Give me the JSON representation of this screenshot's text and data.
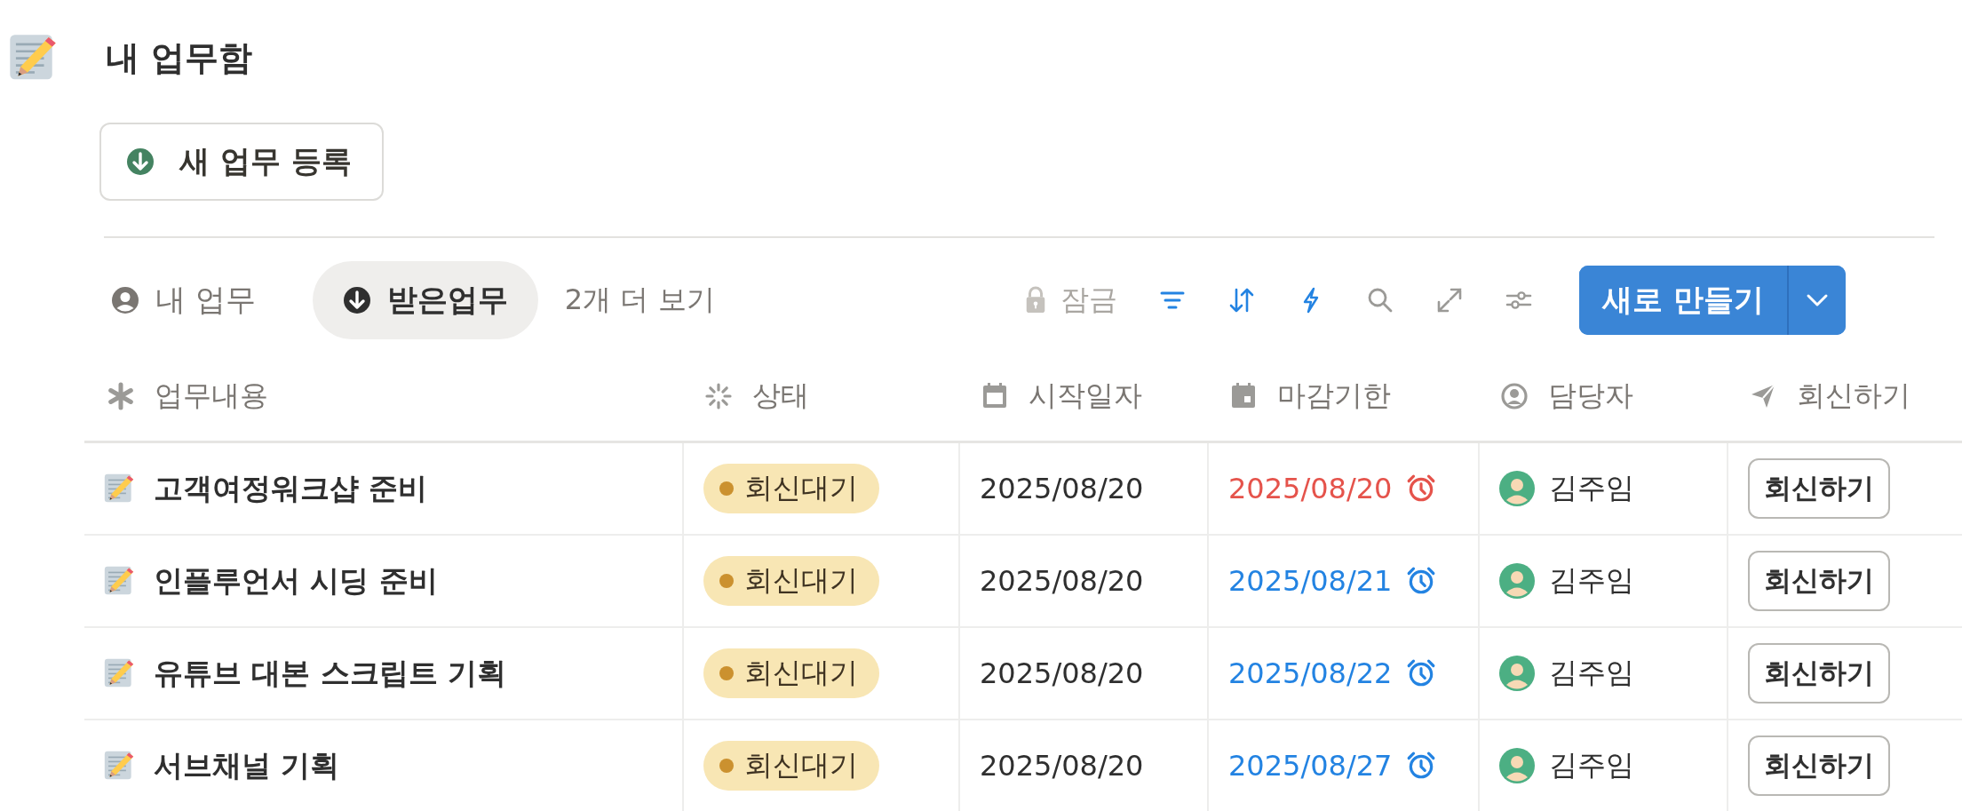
{
  "page": {
    "title": "내 업무함"
  },
  "new_task_button": {
    "label": "새 업무 등록"
  },
  "tabs": [
    {
      "label": "내 업무",
      "selected": false,
      "kind": "person"
    },
    {
      "label": "받은업무",
      "selected": true,
      "kind": "download"
    }
  ],
  "more_views": "2개 더 보기",
  "toolbar": {
    "lock_label": "잠금",
    "create_button": "새로 만들기"
  },
  "table": {
    "columns": [
      {
        "label": "업무내용",
        "kind": "asterisk"
      },
      {
        "label": "상태",
        "kind": "status"
      },
      {
        "label": "시작일자",
        "kind": "calendar"
      },
      {
        "label": "마감기한",
        "kind": "due"
      },
      {
        "label": "담당자",
        "kind": "person"
      },
      {
        "label": "회신하기",
        "kind": "send"
      }
    ],
    "rows": [
      {
        "task": "고객여정워크샵 준비",
        "status": "회신대기",
        "start": "2025/08/20",
        "due": "2025/08/20",
        "color": "#e5534b",
        "assignee": "김주임",
        "action": "회신하기"
      },
      {
        "task": "인플루언서 시딩 준비",
        "status": "회신대기",
        "start": "2025/08/20",
        "due": "2025/08/21",
        "color": "#2383e2",
        "assignee": "김주임",
        "action": "회신하기"
      },
      {
        "task": "유튜브 대본 스크립트 기획",
        "status": "회신대기",
        "start": "2025/08/20",
        "due": "2025/08/22",
        "color": "#2383e2",
        "assignee": "김주임",
        "action": "회신하기"
      },
      {
        "task": "서브채널 기획",
        "status": "회신대기",
        "start": "2025/08/20",
        "due": "2025/08/27",
        "color": "#2383e2",
        "assignee": "김주임",
        "action": "회신하기"
      }
    ]
  }
}
